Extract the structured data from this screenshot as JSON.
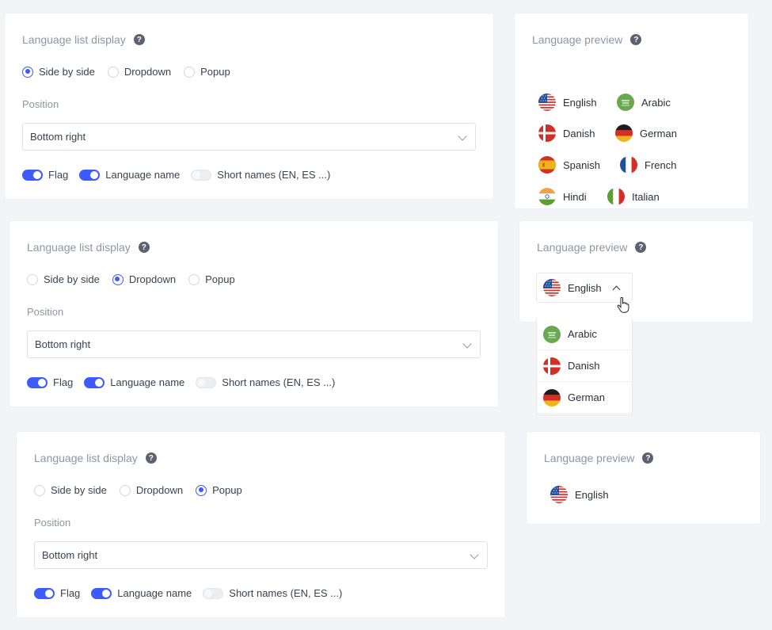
{
  "panels": [
    {
      "settings": {
        "title": "Language list display",
        "display_options": [
          "Side by side",
          "Dropdown",
          "Popup"
        ],
        "selected": "Side by side",
        "position_label": "Position",
        "position_value": "Bottom right",
        "toggles": {
          "flag": "Flag",
          "language_name": "Language name",
          "short_names": "Short names (EN, ES ...)"
        },
        "toggle_states": {
          "flag": true,
          "language_name": true,
          "short_names": false
        }
      },
      "preview": {
        "title": "Language preview",
        "languages": [
          {
            "name": "English",
            "flag": "us"
          },
          {
            "name": "Arabic",
            "flag": "sa"
          },
          {
            "name": "Danish",
            "flag": "dk"
          },
          {
            "name": "German",
            "flag": "de"
          },
          {
            "name": "Spanish",
            "flag": "es"
          },
          {
            "name": "French",
            "flag": "fr"
          },
          {
            "name": "Hindi",
            "flag": "in"
          },
          {
            "name": "Italian",
            "flag": "it"
          }
        ]
      }
    },
    {
      "settings": {
        "title": "Language list display",
        "display_options": [
          "Side by side",
          "Dropdown",
          "Popup"
        ],
        "selected": "Dropdown",
        "position_label": "Position",
        "position_value": "Bottom right",
        "toggles": {
          "flag": "Flag",
          "language_name": "Language name",
          "short_names": "Short names (EN, ES ...)"
        },
        "toggle_states": {
          "flag": true,
          "language_name": true,
          "short_names": false
        }
      },
      "preview": {
        "title": "Language preview",
        "current": {
          "name": "English",
          "flag": "us"
        },
        "dropdown_items": [
          {
            "name": "Arabic",
            "flag": "sa"
          },
          {
            "name": "Danish",
            "flag": "dk"
          },
          {
            "name": "German",
            "flag": "de"
          }
        ]
      }
    },
    {
      "settings": {
        "title": "Language list display",
        "display_options": [
          "Side by side",
          "Dropdown",
          "Popup"
        ],
        "selected": "Popup",
        "position_label": "Position",
        "position_value": "Bottom right",
        "toggles": {
          "flag": "Flag",
          "language_name": "Language name",
          "short_names": "Short names (EN, ES ...)"
        },
        "toggle_states": {
          "flag": true,
          "language_name": true,
          "short_names": false
        }
      },
      "preview": {
        "title": "Language preview",
        "current": {
          "name": "English",
          "flag": "us"
        }
      }
    }
  ],
  "help_icon": "?",
  "icons": {
    "help": "question-circle-icon",
    "cursor": "hand-pointer-icon"
  },
  "colors": {
    "accent": "#3d5afe",
    "muted_text": "#8f95a3",
    "text": "#3d4150",
    "background": "#f3f4f8"
  }
}
